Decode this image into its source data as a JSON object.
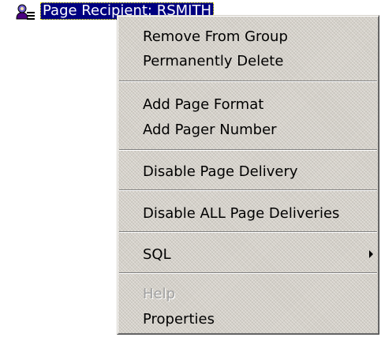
{
  "tree": {
    "node_label": "Page Recipient: RSMITH",
    "icon": "user-recipient-icon"
  },
  "menu": {
    "items": [
      {
        "label": "Remove From Group",
        "enabled": true
      },
      {
        "label": "Permanently Delete",
        "enabled": true
      },
      {
        "label": "Add Page Format",
        "enabled": true
      },
      {
        "label": "Add Pager Number",
        "enabled": true
      },
      {
        "label": "Disable Page Delivery",
        "enabled": true
      },
      {
        "label": "Disable ALL Page Deliveries",
        "enabled": true
      },
      {
        "label": "SQL",
        "enabled": true,
        "submenu": true
      },
      {
        "label": "Help",
        "enabled": false
      },
      {
        "label": "Properties",
        "enabled": true
      }
    ]
  },
  "colors": {
    "selection_bg": "#000080",
    "menu_bg": "#d4d0c8",
    "disabled_text": "#a0a0a0"
  }
}
